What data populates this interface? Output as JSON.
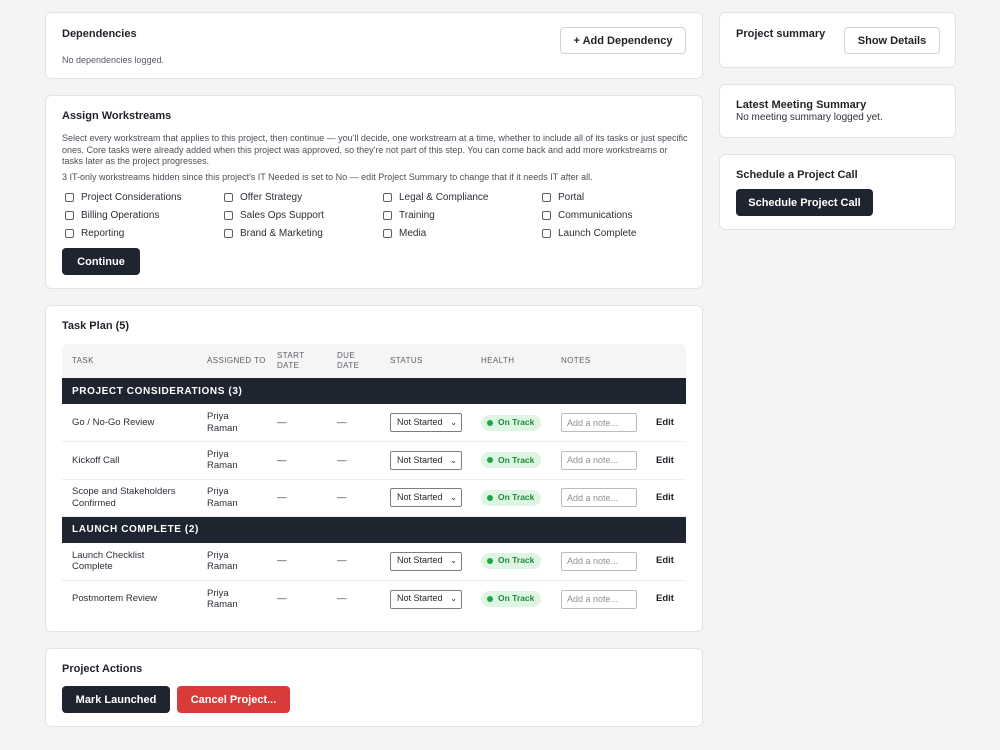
{
  "dependencies": {
    "title": "Dependencies",
    "add_button": "+ Add Dependency",
    "empty_text": "No dependencies logged."
  },
  "assign": {
    "title": "Assign Workstreams",
    "description": "Select every workstream that applies to this project, then continue — you'll decide, one workstream at a time, whether to include all of its tasks or just specific ones. Core tasks were already added when this project was approved, so they're not part of this step. You can come back and add more workstreams or tasks later as the project progresses.",
    "hidden_note": "3 IT-only workstreams hidden since this project's IT Needed is set to No — edit Project Summary to change that if it needs IT after all.",
    "workstreams": [
      "Project Considerations",
      "Offer Strategy",
      "Legal & Compliance",
      "Portal",
      "Billing Operations",
      "Sales Ops Support",
      "Training",
      "Communications",
      "Reporting",
      "Brand & Marketing",
      "Media",
      "Launch Complete"
    ],
    "continue_button": "Continue"
  },
  "task_plan": {
    "title": "Task Plan (5)",
    "columns": {
      "task": "TASK",
      "assigned_to": "ASSIGNED TO",
      "start_date": "START DATE",
      "due_date": "DUE DATE",
      "status": "STATUS",
      "health": "HEALTH",
      "notes": "NOTES"
    },
    "groups": [
      {
        "name": "PROJECT CONSIDERATIONS (3)",
        "tasks": [
          {
            "task": "Go / No-Go Review",
            "assigned": "Priya Raman",
            "start": "—",
            "due": "—",
            "status": "Not Started",
            "health": "On Track",
            "note_placeholder": "Add a note...",
            "action": "Edit"
          },
          {
            "task": "Kickoff Call",
            "assigned": "Priya Raman",
            "start": "—",
            "due": "—",
            "status": "Not Started",
            "health": "On Track",
            "note_placeholder": "Add a note...",
            "action": "Edit"
          },
          {
            "task": "Scope and Stakeholders Confirmed",
            "assigned": "Priya Raman",
            "start": "—",
            "due": "—",
            "status": "Not Started",
            "health": "On Track",
            "note_placeholder": "Add a note...",
            "action": "Edit"
          }
        ]
      },
      {
        "name": "LAUNCH COMPLETE (2)",
        "tasks": [
          {
            "task": "Launch Checklist Complete",
            "assigned": "Priya Raman",
            "start": "—",
            "due": "—",
            "status": "Not Started",
            "health": "On Track",
            "note_placeholder": "Add a note...",
            "action": "Edit"
          },
          {
            "task": "Postmortem Review",
            "assigned": "Priya Raman",
            "start": "—",
            "due": "—",
            "status": "Not Started",
            "health": "On Track",
            "note_placeholder": "Add a note...",
            "action": "Edit"
          }
        ]
      }
    ]
  },
  "project_actions": {
    "title": "Project Actions",
    "mark_launched": "Mark Launched",
    "cancel_project": "Cancel Project..."
  },
  "summary": {
    "title": "Project summary",
    "show_details": "Show Details"
  },
  "meeting": {
    "title": "Latest Meeting Summary",
    "empty_text": "No meeting summary logged yet."
  },
  "schedule": {
    "title": "Schedule a Project Call",
    "button": "Schedule Project Call"
  },
  "colors": {
    "dark": "#1e2530",
    "danger": "#d93b3b",
    "health_bg": "#dff5e3",
    "health_text": "#1e8a3a"
  }
}
